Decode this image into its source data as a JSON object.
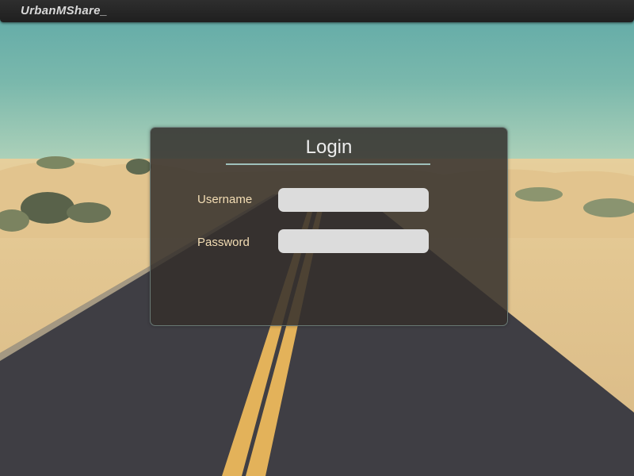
{
  "app": {
    "brand": "UrbanMShare_"
  },
  "login": {
    "title": "Login",
    "username_label": "Username",
    "username_value": "",
    "username_placeholder": "",
    "password_label": "Password",
    "password_value": "",
    "password_placeholder": ""
  },
  "colors": {
    "topbar": "#262626",
    "panel": "#34302c",
    "label": "#f3ddb4",
    "input": "#dcdcdc",
    "title_rule": "#9fc0bb"
  }
}
